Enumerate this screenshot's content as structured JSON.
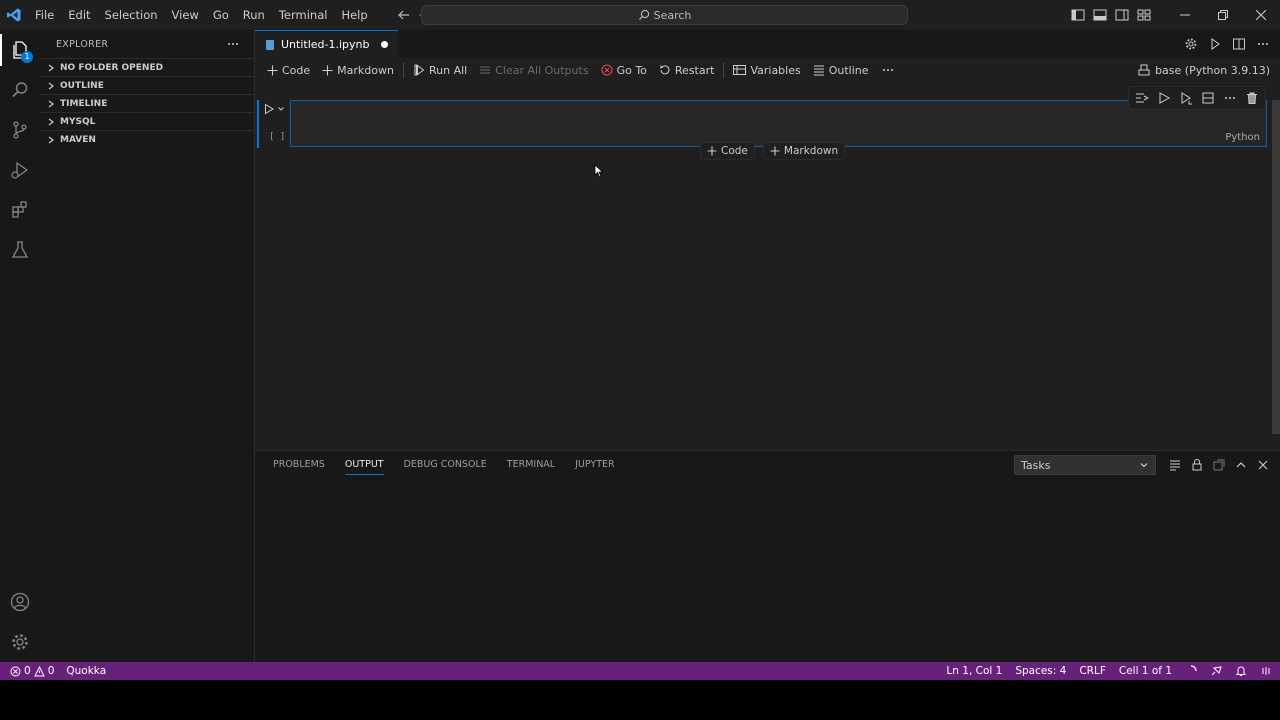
{
  "titlebar": {
    "menu": [
      "File",
      "Edit",
      "Selection",
      "View",
      "Go",
      "Run",
      "Terminal",
      "Help"
    ],
    "search_label": "Search"
  },
  "activity": {
    "explorer_badge": "1"
  },
  "sidebar": {
    "title": "EXPLORER",
    "sections": [
      "NO FOLDER OPENED",
      "OUTLINE",
      "TIMELINE",
      "MYSQL",
      "MAVEN"
    ]
  },
  "editor": {
    "tab_label": "Untitled-1.ipynb",
    "toolbar": {
      "code": "Code",
      "markdown": "Markdown",
      "run_all": "Run All",
      "clear_outputs": "Clear All Outputs",
      "go_to": "Go To",
      "restart": "Restart",
      "variables": "Variables",
      "outline": "Outline"
    },
    "kernel": "base (Python 3.9.13)",
    "cell": {
      "execution_count": "[ ]",
      "language": "Python"
    },
    "add_cell": {
      "code": "Code",
      "markdown": "Markdown"
    }
  },
  "panel": {
    "tabs": [
      "PROBLEMS",
      "OUTPUT",
      "DEBUG CONSOLE",
      "TERMINAL",
      "JUPYTER"
    ],
    "active_tab": "OUTPUT",
    "task_select": "Tasks"
  },
  "statusbar": {
    "errors": "0",
    "warnings": "0",
    "extension": "Quokka",
    "position": "Ln 1, Col 1",
    "spaces": "Spaces: 4",
    "eol": "CRLF",
    "cell": "Cell 1 of 1"
  },
  "colors": {
    "accent": "#0078d4",
    "statusbar": "#68217a",
    "error_icon": "#f14c4c"
  }
}
